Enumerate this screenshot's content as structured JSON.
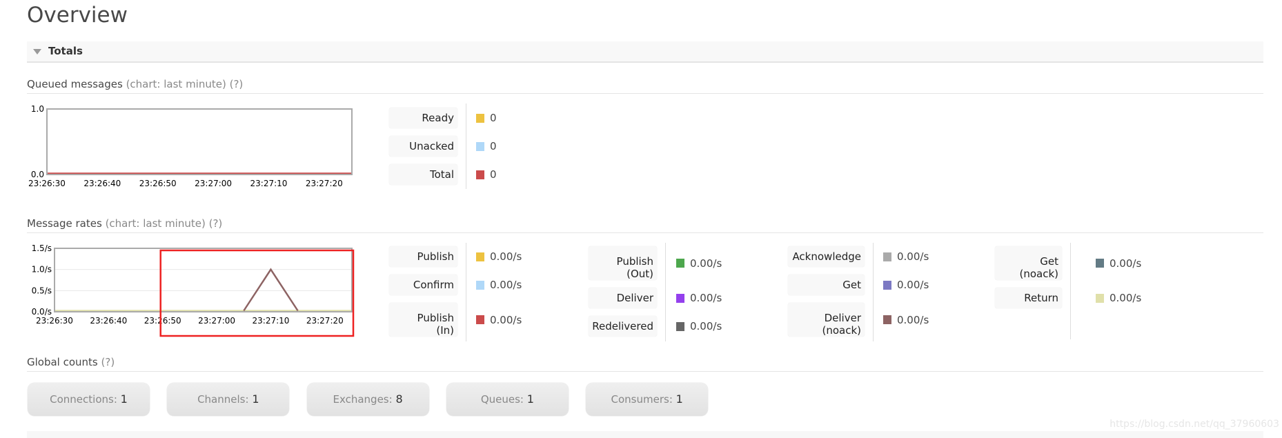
{
  "title": "Overview",
  "section": "Totals",
  "queued": {
    "heading": "Queued messages",
    "sub": "(chart: last minute)",
    "help": "(?)",
    "items": [
      {
        "label": "Ready",
        "value": "0",
        "color": "#edc240"
      },
      {
        "label": "Unacked",
        "value": "0",
        "color": "#afd8f8"
      },
      {
        "label": "Total",
        "value": "0",
        "color": "#cb4b4b"
      }
    ]
  },
  "rates": {
    "heading": "Message rates",
    "sub": "(chart: last minute)",
    "help": "(?)",
    "columns": [
      [
        {
          "label": "Publish",
          "value": "0.00/s",
          "color": "#edc240"
        },
        {
          "label": "Confirm",
          "value": "0.00/s",
          "color": "#afd8f8"
        },
        {
          "label": "Publish (In)",
          "value": "0.00/s",
          "color": "#cb4b4b"
        }
      ],
      [
        {
          "label": "Publish (Out)",
          "value": "0.00/s",
          "color": "#4da74d"
        },
        {
          "label": "Deliver",
          "value": "0.00/s",
          "color": "#9440ed"
        },
        {
          "label": "Redelivered",
          "value": "0.00/s",
          "color": "#666666"
        }
      ],
      [
        {
          "label": "Acknowledge",
          "value": "0.00/s",
          "color": "#aaaaaa"
        },
        {
          "label": "Get",
          "value": "0.00/s",
          "color": "#7c79c3"
        },
        {
          "label": "Deliver (noack)",
          "value": "0.00/s",
          "color": "#8d6363"
        }
      ],
      [
        {
          "label": "Get (noack)",
          "value": "0.00/s",
          "color": "#637b85"
        },
        {
          "label": "Return",
          "value": "0.00/s",
          "color": "#e0e0aa"
        }
      ]
    ]
  },
  "global": {
    "heading": "Global counts",
    "help": "(?)",
    "counts": [
      {
        "label": "Connections:",
        "value": "1"
      },
      {
        "label": "Channels:",
        "value": "1"
      },
      {
        "label": "Exchanges:",
        "value": "8"
      },
      {
        "label": "Queues:",
        "value": "1"
      },
      {
        "label": "Consumers:",
        "value": "1"
      }
    ]
  },
  "watermark": "https://blog.csdn.net/qq_37960603",
  "chart_data": [
    {
      "type": "line",
      "x_ticks": [
        "23:26:30",
        "23:26:40",
        "23:26:50",
        "23:27:00",
        "23:27:10",
        "23:27:20"
      ],
      "y_ticks": [
        "0.0",
        "1.0"
      ],
      "ylim": [
        0,
        1
      ],
      "xlim": [
        "23:26:30",
        "23:27:25"
      ],
      "series": [
        {
          "name": "Total",
          "color": "#cb4b4b",
          "points": [
            [
              "23:26:30",
              0
            ],
            [
              "23:27:25",
              0
            ]
          ]
        }
      ]
    },
    {
      "type": "line",
      "x_ticks": [
        "23:26:30",
        "23:26:40",
        "23:26:50",
        "23:27:00",
        "23:27:10",
        "23:27:20"
      ],
      "y_ticks": [
        "0.0/s",
        "0.5/s",
        "1.0/s",
        "1.5/s"
      ],
      "ylim": [
        0,
        1.5
      ],
      "xlim": [
        "23:26:30",
        "23:27:25"
      ],
      "grid": true,
      "highlight_box": {
        "color": "#ee2222",
        "from": "23:26:50",
        "to": "23:27:25"
      },
      "series": [
        {
          "name": "Return",
          "color": "#e0e0aa",
          "points": [
            [
              "23:26:30",
              0
            ],
            [
              "23:27:25",
              0
            ]
          ]
        },
        {
          "name": "Deliver (noack)",
          "color": "#8d6363",
          "points": [
            [
              "23:27:05",
              0
            ],
            [
              "23:27:10",
              1
            ],
            [
              "23:27:15",
              0
            ]
          ]
        }
      ]
    }
  ]
}
